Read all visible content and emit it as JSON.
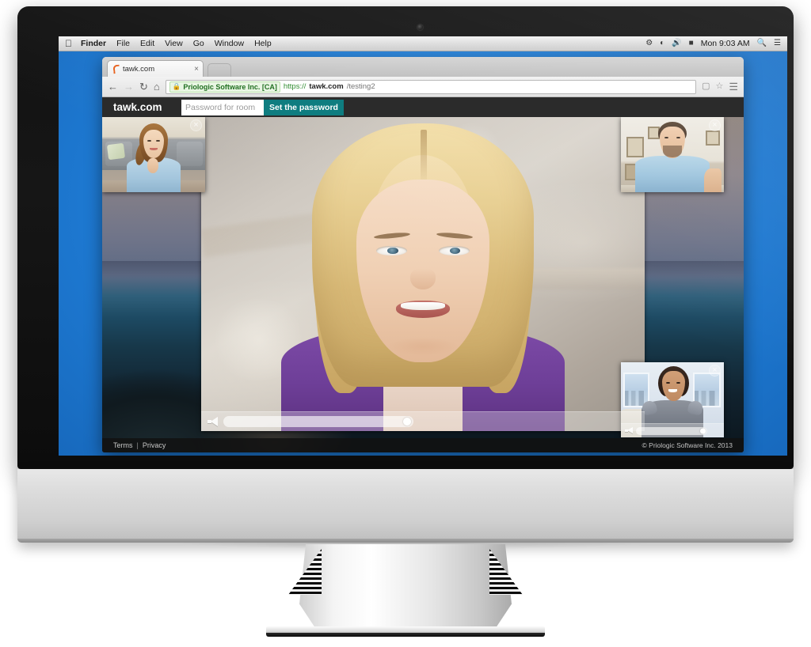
{
  "os": {
    "menubar": {
      "apple_glyph": "apple-logo",
      "items": [
        {
          "label": "Finder",
          "bold": true
        },
        {
          "label": "File",
          "bold": false
        },
        {
          "label": "Edit",
          "bold": false
        },
        {
          "label": "View",
          "bold": false
        },
        {
          "label": "Go",
          "bold": false
        },
        {
          "label": "Window",
          "bold": false
        },
        {
          "label": "Help",
          "bold": false
        }
      ],
      "status_icons": [
        "bluetooth-icon",
        "wifi-icon",
        "volume-icon",
        "battery-icon"
      ],
      "clock": "Mon 9:03 AM",
      "search_icon": "spotlight-search-icon",
      "notifications_icon": "notification-center-icon"
    }
  },
  "browser": {
    "tab": {
      "title": "tawk.com",
      "favicon": "tawk-favicon",
      "close_icon": "close-icon"
    },
    "new_tab_icon": "new-tab-button",
    "toolbar": {
      "back_icon": "back-arrow-icon",
      "forward_icon": "forward-arrow-icon",
      "reload_icon": "reload-icon",
      "home_icon": "home-icon",
      "lock_icon": "lock-icon",
      "ev_certificate": "Priologic Software Inc. [CA]",
      "url_scheme": "https://",
      "url_host": "tawk.com",
      "url_path": "/testing2",
      "cast_icon": "screencast-icon",
      "bookmark_icon": "star-icon",
      "menu_icon": "hamburger-menu-icon"
    }
  },
  "app": {
    "header": {
      "brand": "tawk.com",
      "password_value": "",
      "password_placeholder": "Password for room",
      "set_password_label": "Set the password",
      "accent_color": "#0f7d80"
    },
    "videos": {
      "main": {
        "name": "main-video-blonde-woman",
        "close_icon": "close-icon",
        "speaker_icon": "speaker-icon",
        "volume_level": "100"
      },
      "thumbnails": [
        {
          "name": "thumbnail-video-woman-couch",
          "close_icon": "close-icon",
          "position": "top-left"
        },
        {
          "name": "thumbnail-video-man",
          "close_icon": "close-icon",
          "position": "top-right"
        },
        {
          "name": "thumbnail-video-woman-office",
          "close_icon": "close-icon",
          "position": "bottom-right",
          "speaker_icon": "speaker-icon",
          "volume_level": "100"
        }
      ]
    },
    "footer": {
      "terms_label": "Terms",
      "separator": "|",
      "privacy_label": "Privacy",
      "copyright": "© Priologic Software Inc. 2013"
    }
  },
  "hardware": {
    "device": "imac-display",
    "camera_icon": "webcam-icon",
    "desktop_color": "#2181DC"
  }
}
